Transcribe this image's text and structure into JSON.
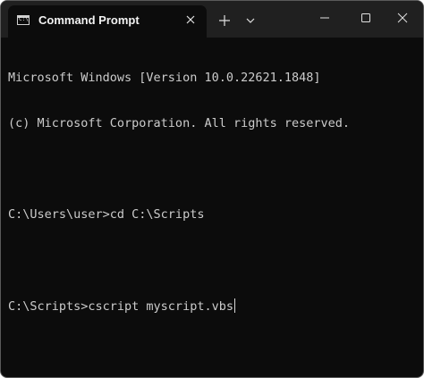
{
  "tab": {
    "title": "Command Prompt",
    "icon_glyph": "C:\\"
  },
  "icons": {
    "tab_icon": "console-icon",
    "close_tab": "close-icon",
    "new_tab": "plus-icon",
    "dropdown": "chevron-down-icon",
    "minimize": "minimize-icon",
    "maximize": "maximize-icon",
    "close_window": "close-icon"
  },
  "colors": {
    "titlebar": "#202020",
    "tab_background": "#0c0c0c",
    "terminal_background": "#0c0c0c",
    "terminal_text": "#cccccc"
  },
  "terminal": {
    "lines": [
      "Microsoft Windows [Version 10.0.22621.1848]",
      "(c) Microsoft Corporation. All rights reserved.",
      "",
      "C:\\Users\\user>cd C:\\Scripts",
      "",
      "C:\\Scripts>cscript myscript.vbs"
    ]
  }
}
